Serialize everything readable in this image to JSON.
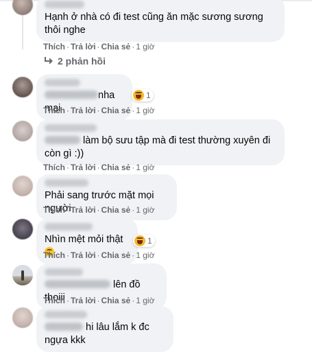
{
  "comments": [
    {
      "text": "Hạnh ở nhà có đi test cũng ăn mặc sương sương thôi nghe",
      "actions": {
        "like": "Thích",
        "reply": "Trả lời",
        "share": "Chia sẻ",
        "time": "1 giờ"
      },
      "replies_label": "2 phản hồi"
    },
    {
      "text_visible": "nha mại",
      "reaction": {
        "type": "haha",
        "count": "1"
      },
      "actions": {
        "like": "Thích",
        "reply": "Trả lời",
        "share": "Chia sẻ",
        "time": "1 giờ"
      }
    },
    {
      "text_line1": "làm bộ sưu tập mà đi test thường xuyên đi",
      "text_line2": "còn gì :))",
      "actions": {
        "like": "Thích",
        "reply": "Trả lời",
        "share": "Chia sẻ",
        "time": "1 giờ"
      }
    },
    {
      "text": "Phải sang trước mặt mọi người",
      "actions": {
        "like": "Thích",
        "reply": "Trả lời",
        "share": "Chia sẻ",
        "time": "1 giờ"
      }
    },
    {
      "text": "Nhìn mệt mỏi thật",
      "emoji": "upside-down-face",
      "reaction": {
        "type": "haha",
        "count": "1"
      },
      "actions": {
        "like": "Thích",
        "reply": "Trả lời",
        "share": "Chia sẻ",
        "time": "1 giờ"
      }
    },
    {
      "text_visible": "lên đồ thoiii",
      "actions": {
        "like": "Thích",
        "reply": "Trả lời",
        "share": "Chia sẻ",
        "time": "1 giờ"
      }
    },
    {
      "text_visible": "hi lâu lắm k đc ngựa kkk"
    }
  ],
  "separator": "·",
  "colors": {
    "bubble": "#f0f2f5",
    "meta_text": "#65676b",
    "text": "#050505",
    "haha": "#f5b92e"
  }
}
